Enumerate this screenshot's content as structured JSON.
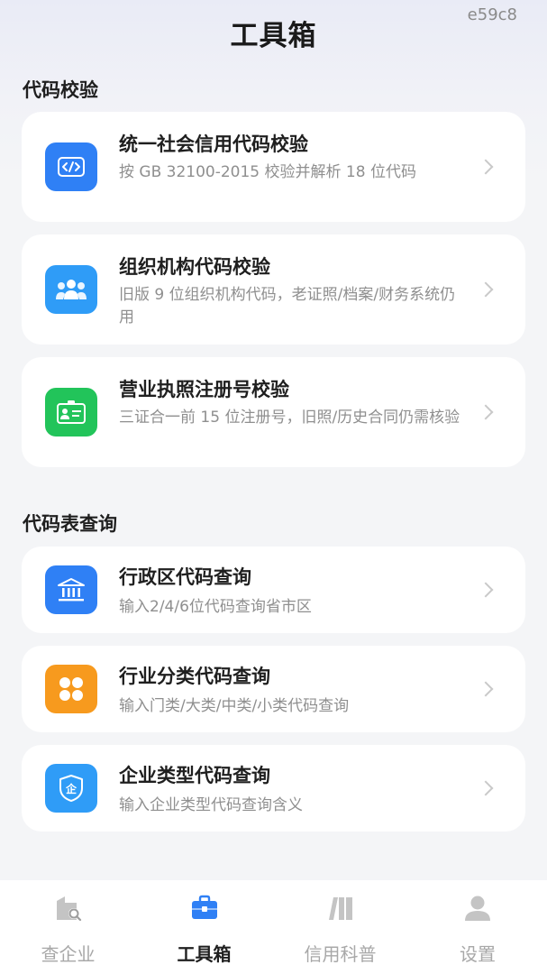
{
  "header": {
    "title": "工具箱",
    "corner_code": "e59c8"
  },
  "colors": {
    "blue": "#2f80f5",
    "green": "#22c45a",
    "orange": "#f79a1e",
    "bg": "#f4f5f7",
    "tab_active": "#2f80f5"
  },
  "sections": [
    {
      "title": "代码校验",
      "items": [
        {
          "title": "统一社会信用代码校验",
          "desc": "按 GB 32100-2015 校验并解析 18 位代码",
          "icon": "code-icon"
        },
        {
          "title": "组织机构代码校验",
          "desc": "旧版 9 位组织机构代码，老证照/档案/财务系统仍用",
          "icon": "people-icon"
        },
        {
          "title": "营业执照注册号校验",
          "desc": "三证合一前 15 位注册号，旧照/历史合同仍需核验",
          "icon": "id-card-icon"
        }
      ]
    },
    {
      "title": "代码表查询",
      "items": [
        {
          "title": "行政区代码查询",
          "desc": "输入2/4/6位代码查询省市区",
          "icon": "government-building-icon"
        },
        {
          "title": "行业分类代码查询",
          "desc": "输入门类/大类/中类/小类代码查询",
          "icon": "clover-icon"
        },
        {
          "title": "企业类型代码查询",
          "desc": "输入企业类型代码查询含义",
          "icon": "shield-icon"
        }
      ]
    }
  ],
  "tabs": [
    {
      "label": "查企业",
      "icon": "company-search-icon",
      "active": false
    },
    {
      "label": "工具箱",
      "icon": "toolbox-icon",
      "active": true
    },
    {
      "label": "信用科普",
      "icon": "books-icon",
      "active": false
    },
    {
      "label": "设置",
      "icon": "user-icon",
      "active": false
    }
  ]
}
